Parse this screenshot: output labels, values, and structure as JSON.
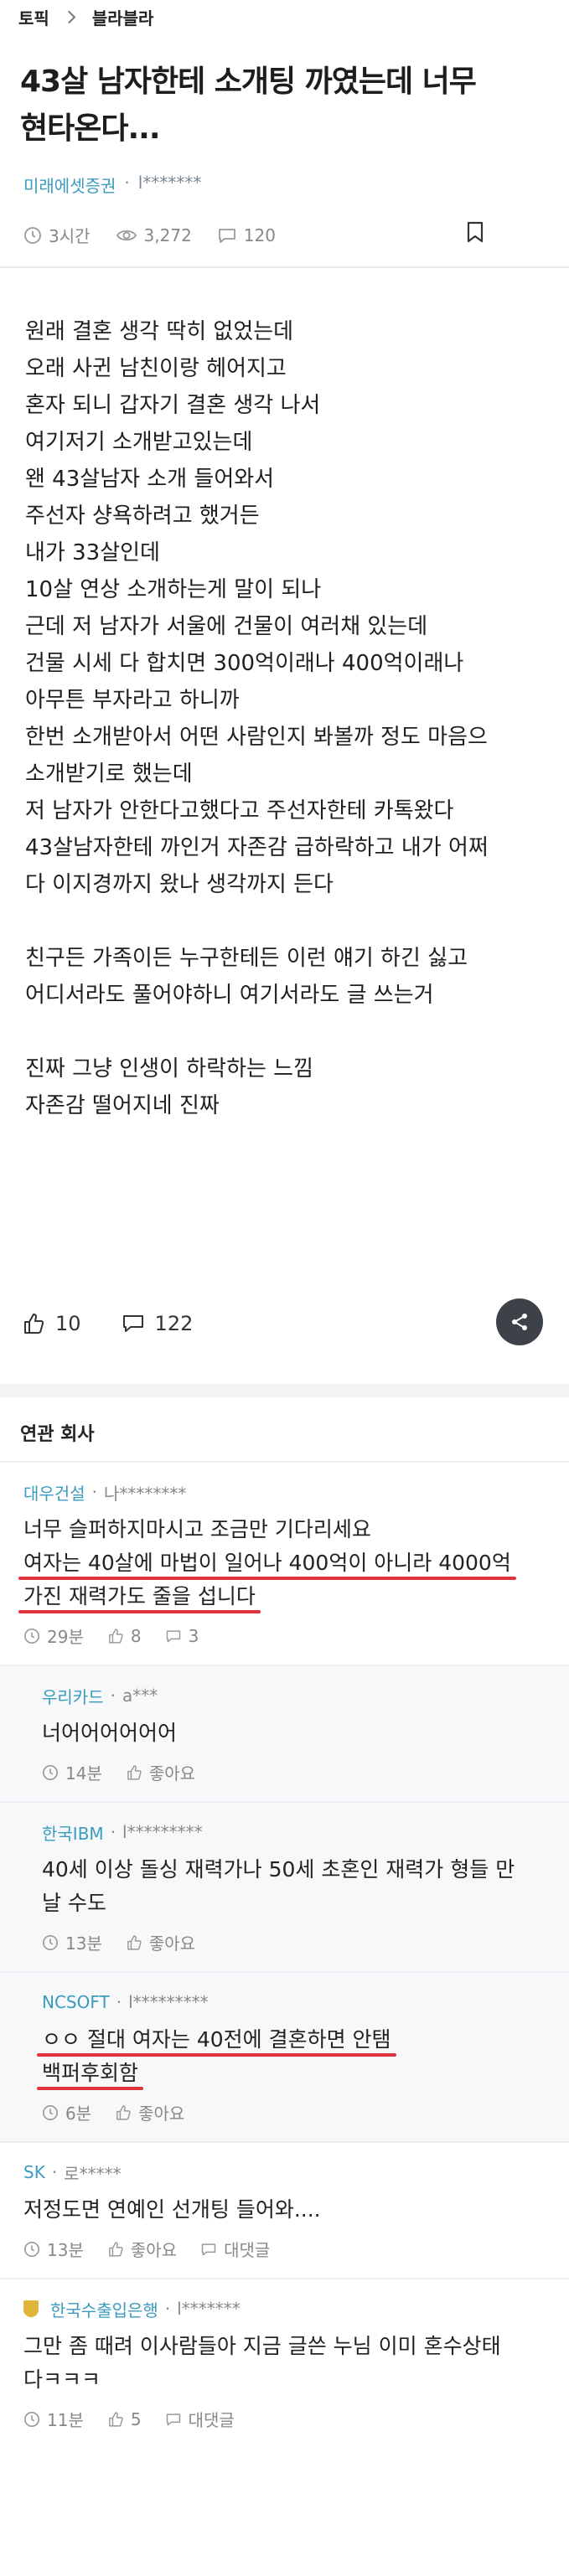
{
  "breadcrumb": {
    "topic": "토픽",
    "board": "블라블라"
  },
  "post": {
    "title_lines": [
      "43살 남자한테 소개팅 까였는데 너무",
      "현타온다..."
    ],
    "company": "미래에셋증권",
    "separator": "·",
    "nickname": "l*******",
    "time": "3시간",
    "views": "3,272",
    "comments": "120",
    "body_lines": [
      "원래 결혼 생각 딱히 없었는데",
      "오래 사귄 남친이랑 헤어지고",
      "혼자 되니 갑자기 결혼 생각 나서",
      "여기저기 소개받고있는데",
      "왠 43살남자 소개 들어와서",
      "주선자 샹욕하려고 했거든",
      "내가 33살인데",
      "10살 연상 소개하는게 말이 되나",
      "근데 저 남자가 서울에 건물이 여러채 있는데",
      "건물 시세 다 합치면 300억이래나 400억이래나",
      "아무튼 부자라고 하니까",
      "한번 소개받아서 어떤 사람인지 봐볼까 정도 마음으",
      "소개받기로 했는데",
      "저 남자가 안한다고했다고 주선자한테 카톡왔다",
      "43살남자한테 까인거 자존감 급하락하고 내가 어쩌",
      "다 이지경까지 왔나 생각까지 든다",
      "",
      "친구든 가족이든 누구한테든 이런 얘기 하긴 싫고",
      "어디서라도 풀어야하니 여기서라도 글 쓰는거",
      "",
      "진짜 그냥 인생이 하락하는 느낌",
      "자존감 떨어지네 진짜"
    ],
    "likes": "10",
    "comment_count": "122"
  },
  "related_title": "연관 회사",
  "comments": [
    {
      "company": "대우건설",
      "nick": "나********",
      "lines": [
        "너무 슬퍼하지마시고 조금만 기다리세요",
        "여자는 40살에 마법이 일어나 400억이 아니라 4000억",
        "가진 재력가도 줄을 섭니다"
      ],
      "time": "29분",
      "likes": "8",
      "replies": "3",
      "reply": false
    },
    {
      "company": "우리카드",
      "nick": "a***",
      "lines": [
        "너어어어어어어"
      ],
      "time": "14분",
      "likes": "좋아요",
      "reply": true
    },
    {
      "company": "한국IBM",
      "nick": "l*********",
      "lines": [
        "40세 이상 돌싱 재력가나 50세 초혼인 재력가 형들 만",
        "날 수도"
      ],
      "time": "13분",
      "likes": "좋아요",
      "reply": true
    },
    {
      "company": "NCSOFT",
      "nick": "l*********",
      "lines": [
        "ㅇㅇ 절대 여자는 40전에 결혼하면 안탬",
        "백퍼후회함"
      ],
      "time": "6분",
      "likes": "좋아요",
      "reply": true
    },
    {
      "company": "SK",
      "nick": "로*****",
      "lines": [
        "저정도면 연예인 선개팅 들어와...."
      ],
      "time": "13분",
      "likes": "좋아요",
      "replies": "대댓글",
      "reply": false
    },
    {
      "company": "한국수출입은행",
      "nick": "l*******",
      "lines": [
        "그만 좀 때려 이사람들아 지금 글쓴 누님 이미 혼수상태",
        "다ㅋㅋㅋ"
      ],
      "time": "11분",
      "likes": "5",
      "replies": "대댓글",
      "reply": false,
      "badge": true
    }
  ],
  "colors": {
    "accent_company": "#3b9bbf",
    "underline": "#e0333c",
    "share_bg": "#3d4148"
  }
}
